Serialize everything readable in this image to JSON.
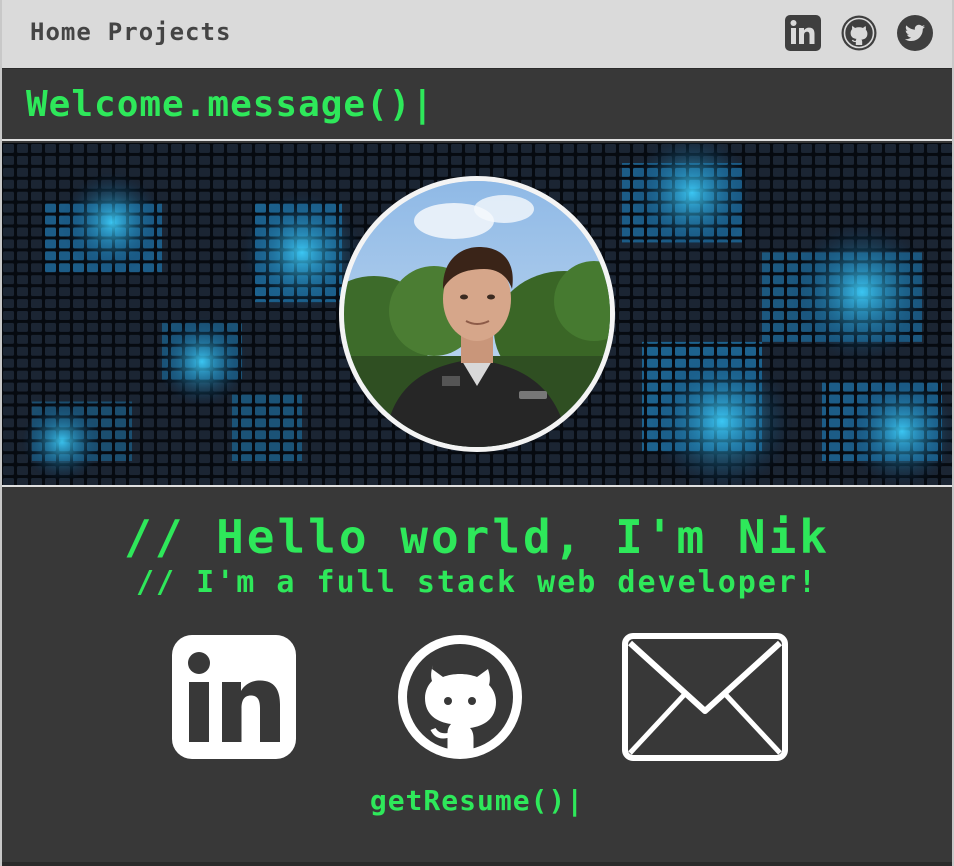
{
  "nav": {
    "links": [
      "Home",
      "Projects"
    ],
    "icons": [
      "linkedin-icon",
      "github-icon",
      "twitter-icon"
    ]
  },
  "welcome": {
    "text": "Welcome.message()|"
  },
  "hero": {
    "background": "digital-matrix-grid",
    "avatar": "profile-photo"
  },
  "intro": {
    "title": "// Hello world, I'm Nik",
    "subtitle": "// I'm a full stack web developer!"
  },
  "social": {
    "icons": [
      "linkedin-icon",
      "github-icon",
      "mail-icon"
    ]
  },
  "resume": {
    "label": "getResume()|"
  },
  "colors": {
    "accent": "#2ee85a",
    "background": "#383838",
    "navbar": "#dadada",
    "nav_icon": "#3f3f3f",
    "social_icon": "#ffffff"
  }
}
